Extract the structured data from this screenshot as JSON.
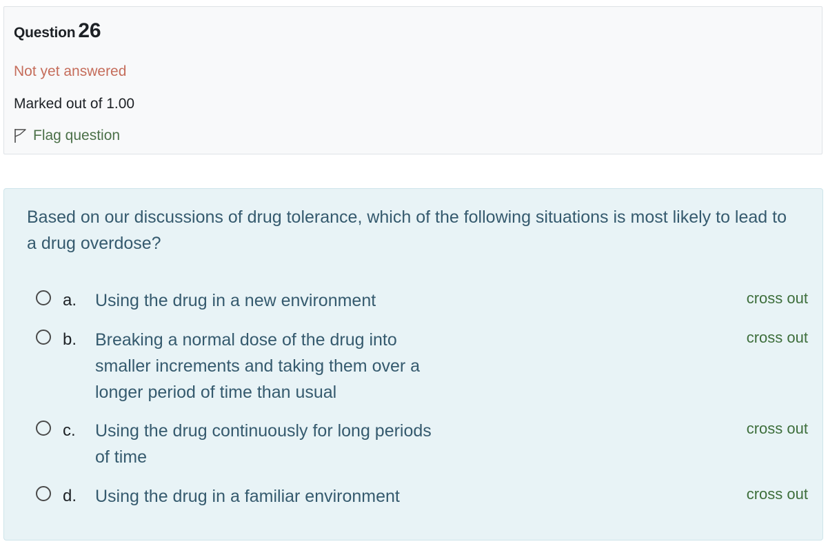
{
  "info": {
    "question_label": "Question",
    "question_number": "26",
    "state": "Not yet answered",
    "grade": "Marked out of 1.00",
    "flag_label": "Flag question"
  },
  "question": {
    "text": "Based on our discussions of drug tolerance, which of the following situations is most likely to lead to a drug overdose?"
  },
  "answers": [
    {
      "letter": "a.",
      "text": "Using the drug in a new environment",
      "cross_out": "cross out"
    },
    {
      "letter": "b.",
      "text": "Breaking a normal dose of the drug into smaller increments and taking them over a longer period of time than usual",
      "cross_out": "cross out"
    },
    {
      "letter": "c.",
      "text": "Using the drug continuously for long periods of time",
      "cross_out": "cross out"
    },
    {
      "letter": "d.",
      "text": "Using the drug in a familiar environment",
      "cross_out": "cross out"
    }
  ],
  "colors": {
    "state": "#c56d5b",
    "link": "#4b7048",
    "question_text": "#355a6e",
    "content_bg": "#e8f3f6"
  },
  "icons": {
    "flag": "flag-outline-icon"
  }
}
